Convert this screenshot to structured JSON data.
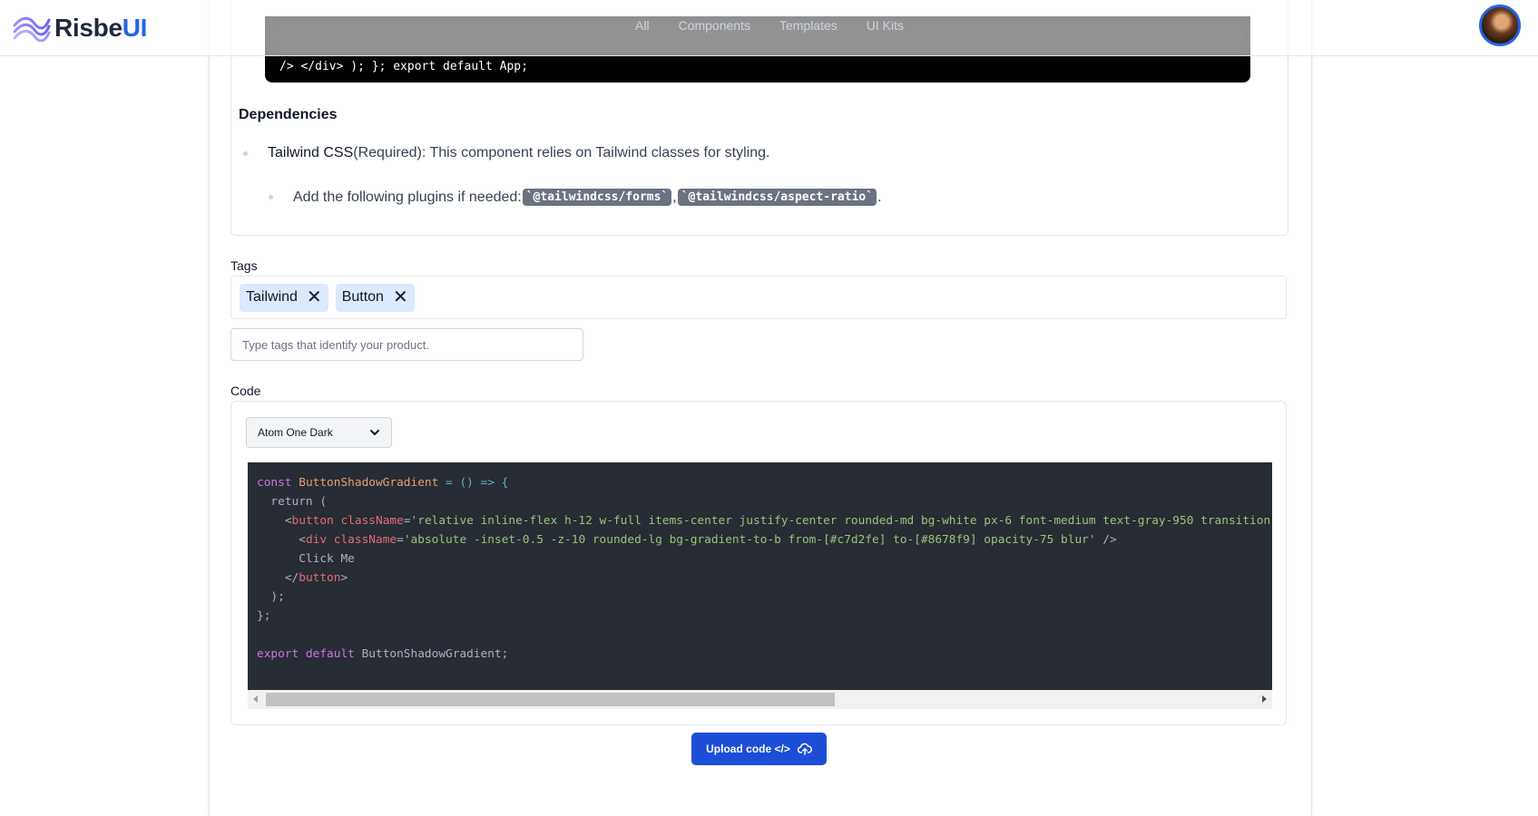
{
  "header": {
    "logo_text_main": "Risbe",
    "logo_text_accent": "UI",
    "nav": [
      "All",
      "Components",
      "Templates",
      "UI Kits"
    ]
  },
  "top_code": {
    "text": "/> </div> ); }; export default App;"
  },
  "dependencies": {
    "title": "Dependencies",
    "item1_name": "Tailwind CSS",
    "item1_desc": " (Required): This component relies on Tailwind classes for styling.",
    "item2_prefix": "Add the following plugins if needed: ",
    "plugin1": "`@tailwindcss/forms`",
    "separator": ",",
    "plugin2": "`@tailwindcss/aspect-ratio`",
    "item2_suffix": "."
  },
  "tags": {
    "label": "Tags",
    "items": [
      "Tailwind",
      "Button"
    ],
    "remove_glyph": "✕",
    "input_placeholder": "Type tags that identify your product."
  },
  "code": {
    "label": "Code",
    "theme_selected": "Atom One Dark",
    "line1_kw": "const ",
    "line1_fn": "ButtonShadowGradient",
    "line1_op": " = () => {",
    "line2": "  return (",
    "line3_indent": "    <",
    "line3_tag": "button",
    "line3_attr": " className",
    "line3_eq": "=",
    "line3_str": "'relative inline-flex h-12 w-full items-center justify-center rounded-md bg-white px-6 font-medium text-gray-950 transition-",
    "line4_indent": "      <",
    "line4_tag": "div",
    "line4_attr": " className",
    "line4_eq": "=",
    "line4_str": "'absolute -inset-0.5 -z-10 rounded-lg bg-gradient-to-b from-[#c7d2fe] to-[#8678f9] opacity-75 blur'",
    "line4_end": " />",
    "line5": "      Click Me",
    "line6_indent": "    </",
    "line6_tag": "button",
    "line6_end": ">",
    "line7": "  );",
    "line8": "};",
    "line10_kw": "export default ",
    "line10_rest": "ButtonShadowGradient;"
  },
  "upload": {
    "label": "Upload code </>"
  },
  "colors": {
    "accent": "#2563eb",
    "button": "#1d4ed8",
    "tag_bg": "#dbeafe",
    "editor_bg": "#282c34"
  }
}
